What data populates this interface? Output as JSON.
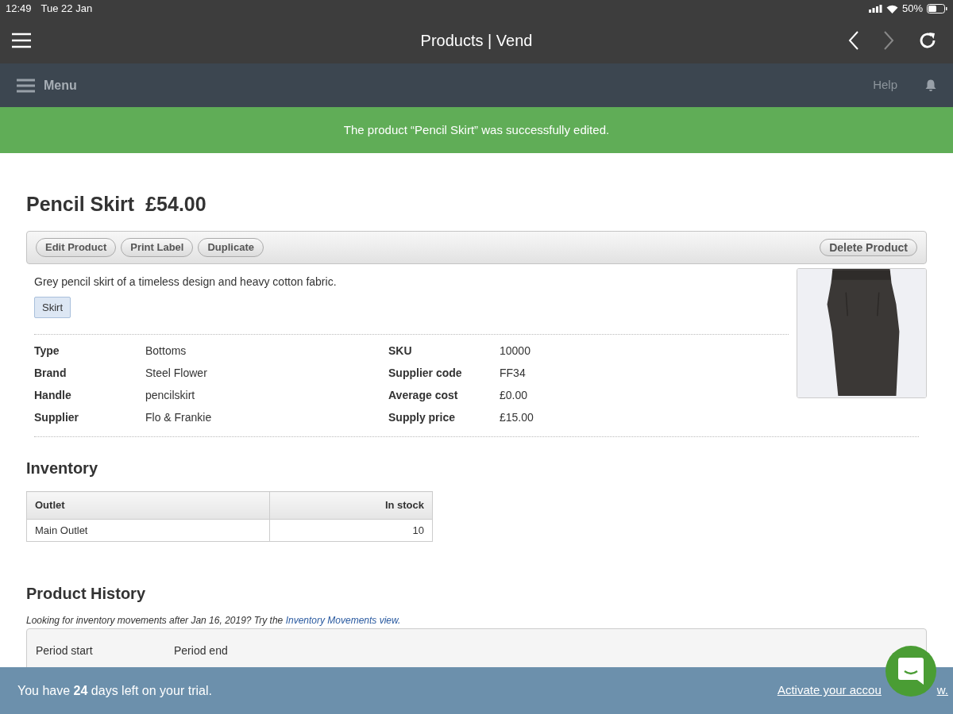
{
  "status_bar": {
    "time": "12:49",
    "date": "Tue 22 Jan",
    "battery": "50%"
  },
  "browser": {
    "title": "Products | Vend"
  },
  "nav": {
    "menu": "Menu",
    "help": "Help"
  },
  "banner": {
    "message": "The product “Pencil Skirt” was successfully edited."
  },
  "product": {
    "name": "Pencil Skirt",
    "price": "£54.00",
    "description": "Grey pencil skirt of a timeless design and heavy cotton fabric.",
    "tags": [
      "Skirt"
    ],
    "image": {
      "kind": "picture"
    }
  },
  "actions": [
    "Edit Product",
    "Print Label",
    "Duplicate"
  ],
  "delete_action": "Delete Product",
  "details_left": [
    {
      "label": "Type",
      "value": "Bottoms"
    },
    {
      "label": "Brand",
      "value": "Steel Flower"
    },
    {
      "label": "Handle",
      "value": "pencilskirt"
    },
    {
      "label": "Supplier",
      "value": "Flo & Frankie"
    }
  ],
  "details_right": [
    {
      "label": "SKU",
      "value": "10000"
    },
    {
      "label": "Supplier code",
      "value": "FF34"
    },
    {
      "label": "Average cost",
      "value": "£0.00"
    },
    {
      "label": "Supply price",
      "value": "£15.00"
    }
  ],
  "inventory": {
    "title": "Inventory",
    "columns": [
      "Outlet",
      "In stock"
    ],
    "rows": [
      [
        "Main Outlet",
        "10"
      ]
    ]
  },
  "history": {
    "title": "Product History",
    "note": "Looking for inventory movements after Jan 16, 2019? Try the ",
    "link": "Inventory Movements view.",
    "columns": [
      "Period start",
      "Period end"
    ]
  },
  "trial": {
    "message": "You have **24** days left on your trial.",
    "link_start": "Activate your accou",
    "link_end": "w."
  }
}
